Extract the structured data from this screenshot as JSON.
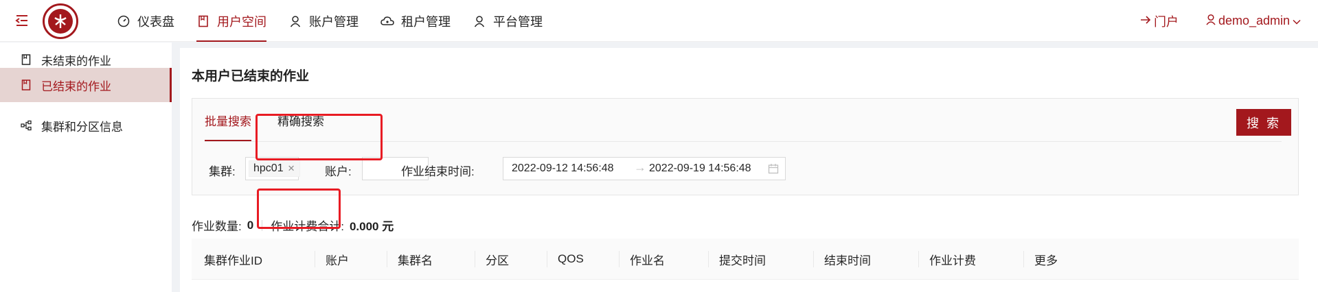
{
  "header": {
    "nav": [
      {
        "label": "仪表盘",
        "icon": "dashboard-icon",
        "active": false
      },
      {
        "label": "用户空间",
        "icon": "book-icon",
        "active": true
      },
      {
        "label": "账户管理",
        "icon": "user-icon",
        "active": false
      },
      {
        "label": "租户管理",
        "icon": "cloud-icon",
        "active": false
      },
      {
        "label": "平台管理",
        "icon": "user-icon",
        "active": false
      }
    ],
    "portal_label": "门户",
    "user_label": "demo_admin"
  },
  "sidebar": {
    "items": [
      {
        "label": "未结束的作业",
        "icon": "book-icon",
        "active": false
      },
      {
        "label": "已结束的作业",
        "icon": "book-icon",
        "active": true
      },
      {
        "label": "集群和分区信息",
        "icon": "cluster-icon",
        "active": false
      }
    ]
  },
  "main": {
    "title": "本用户已结束的作业",
    "tabs": [
      {
        "label": "批量搜索",
        "active": true
      },
      {
        "label": "精确搜索",
        "active": false
      }
    ],
    "search_button": "搜 索",
    "filters": {
      "cluster_label": "集群:",
      "cluster_tag": "hpc01",
      "account_label": "账户:",
      "account_value": "",
      "end_time_label": "作业结束时间:",
      "start_date": "2022-09-12 14:56:48",
      "end_date": "2022-09-19 14:56:48"
    },
    "summary": {
      "count_label": "作业数量:",
      "count_value": "0",
      "cost_label": "作业计费合计:",
      "cost_value": "0.000 元"
    },
    "table": {
      "columns": [
        "集群作业ID",
        "账户",
        "集群名",
        "分区",
        "QOS",
        "作业名",
        "提交时间",
        "结束时间",
        "作业计费",
        "更多"
      ]
    }
  },
  "colors": {
    "brand": "#a3181d",
    "highlight_box": "#e81b23",
    "active_bg": "#e6d4d2"
  }
}
